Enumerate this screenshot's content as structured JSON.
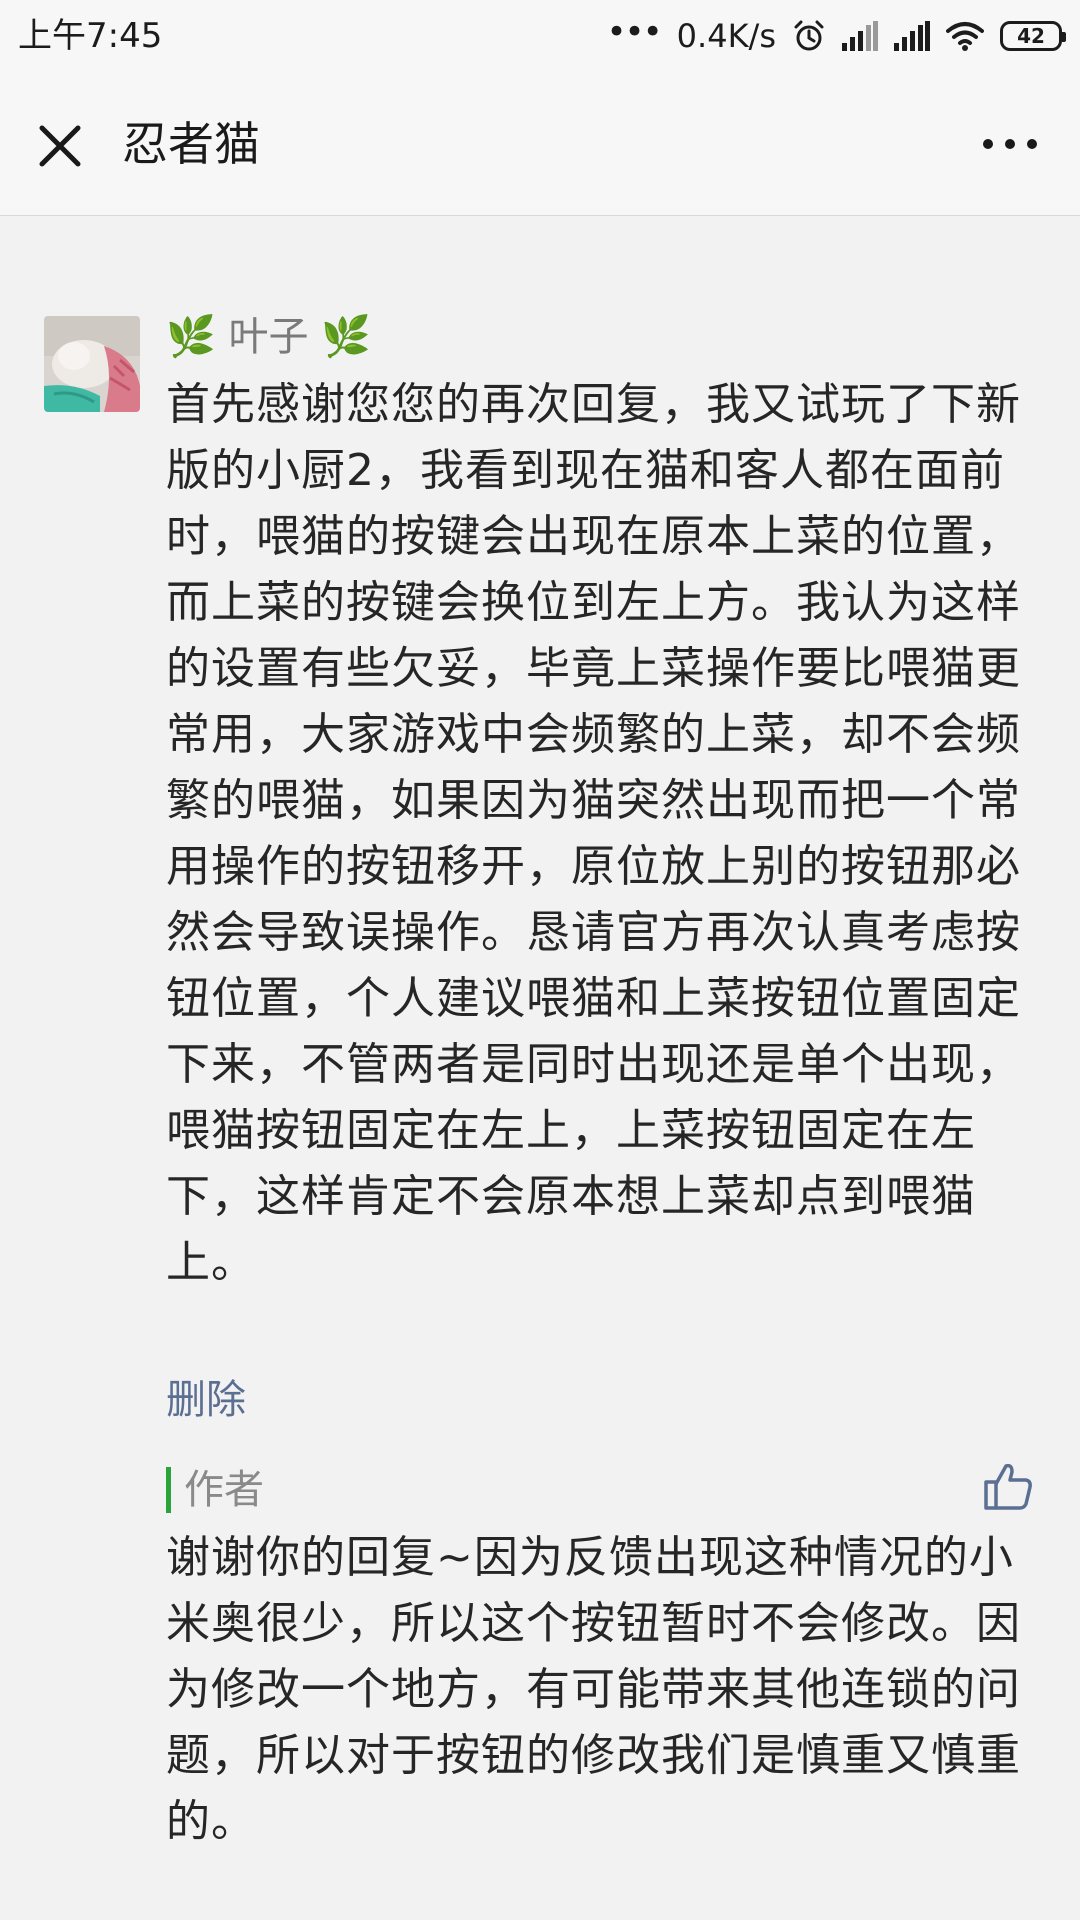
{
  "status_bar": {
    "time": "上午7:45",
    "dots": "•••",
    "speed": "0.4K/s",
    "battery": "42",
    "icons": [
      "alarm-icon",
      "signal-icon",
      "signal-icon",
      "wifi-icon",
      "battery-icon"
    ]
  },
  "header": {
    "title": "忍者猫",
    "close_icon": "close-icon",
    "more_icon": "more-icon"
  },
  "comment": {
    "author": "🌿 叶子 🌿",
    "text": "首先感谢您您的再次回复，我又试玩了下新版的小厨2，我看到现在猫和客人都在面前时，喂猫的按键会出现在原本上菜的位置，而上菜的按键会换位到左上方。我认为这样的设置有些欠妥，毕竟上菜操作要比喂猫更常用，大家游戏中会频繁的上菜，却不会频繁的喂猫，如果因为猫突然出现而把一个常用操作的按钮移开，原位放上别的按钮那必然会导致误操作。恳请官方再次认真考虑按钮位置，个人建议喂猫和上菜按钮位置固定下来，不管两者是同时出现还是单个出现，喂猫按钮固定在左上，上菜按钮固定在左下，这样肯定不会原本想上菜却点到喂猫上。",
    "delete_label": "删除"
  },
  "reply": {
    "label": "作者",
    "text": "谢谢你的回复~因为反馈出现这种情况的小米奥很少，所以这个按钮暂时不会修改。因为修改一个地方，有可能带来其他连锁的问题，所以对于按钮的修改我们是慎重又慎重的。",
    "like_icon": "thumbs-up-icon"
  },
  "colors": {
    "background": "#f2f2f2",
    "link": "#5b6f93",
    "accent_bar": "#2aa33a",
    "like_icon": "#5b6f93"
  }
}
